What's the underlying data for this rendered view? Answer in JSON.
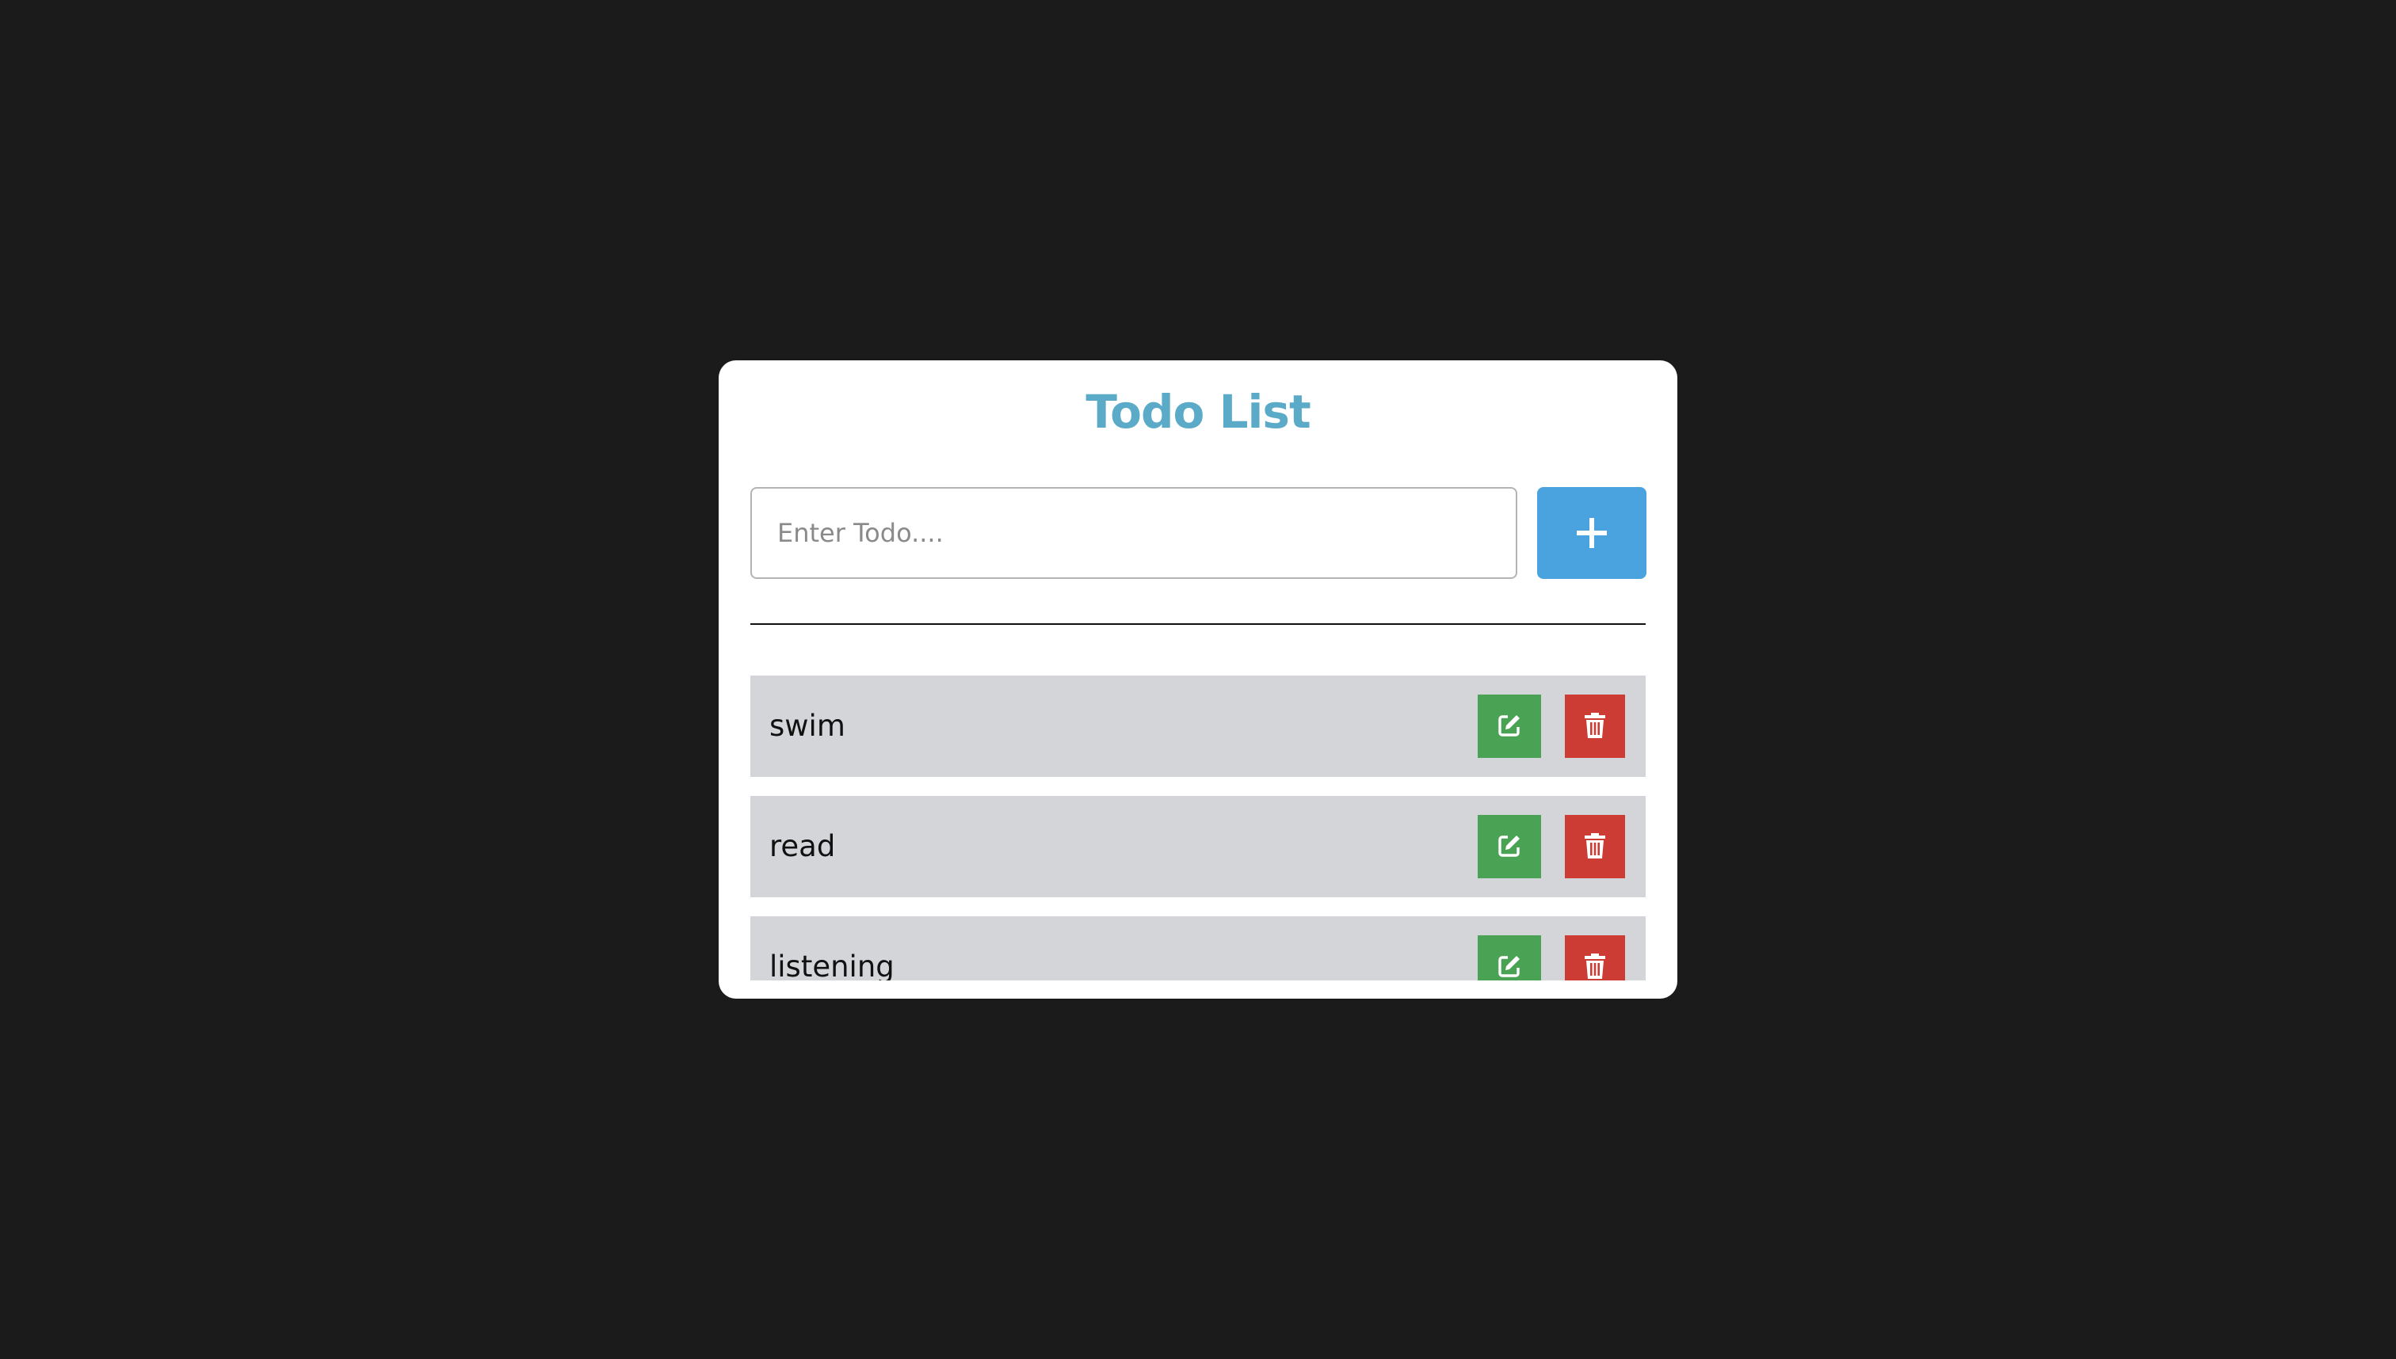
{
  "app": {
    "title": "Todo List"
  },
  "input": {
    "placeholder": "Enter Todo....",
    "value": ""
  },
  "add_button": {
    "icon": "plus-icon"
  },
  "todos": [
    {
      "text": "swim"
    },
    {
      "text": "read"
    },
    {
      "text": "listening"
    }
  ],
  "row_actions": {
    "edit_icon": "edit-icon",
    "delete_icon": "trash-icon"
  },
  "colors": {
    "page_background": "#1b1b1b",
    "card_background": "#ffffff",
    "title": "#5aaac8",
    "add_button": "#4aa3df",
    "row_background": "#d4d5d8",
    "edit_button": "#4aa254",
    "delete_button": "#cc3c35",
    "icon": "#ffffff"
  }
}
